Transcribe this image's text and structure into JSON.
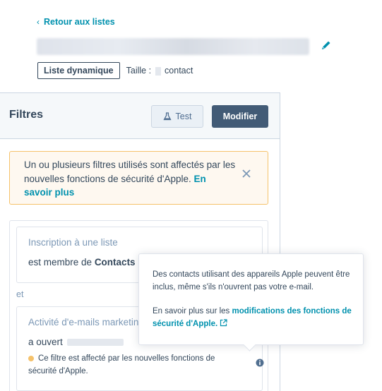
{
  "header": {
    "back_label": "Retour aux listes",
    "list_type": "Liste dynamique",
    "size_label": "Taille :",
    "size_unit": "contact"
  },
  "panel": {
    "title": "Filtres",
    "test_label": "Test",
    "modify_label": "Modifier"
  },
  "alert": {
    "text": "Un ou plusieurs filtres utilisés sont affectés par les nouvelles fonctions de sécurité d'Apple.",
    "link": "En savoir plus"
  },
  "filters": {
    "card1_title": "Inscription à une liste",
    "card1_prefix": "est membre de",
    "card1_value": "Contacts",
    "and_label": "et",
    "card2_title": "Activité d'e-mails marketing",
    "card2_prefix": "a ouvert",
    "card2_warning": "Ce filtre est affecté par les nouvelles fonctions de sécurité d'Apple."
  },
  "tooltip": {
    "paragraph1": "Des contacts utilisant des appareils Apple peuvent être inclus, même s'ils n'ouvrent pas votre e-mail.",
    "paragraph2_prefix": "En savoir plus sur les",
    "paragraph2_link": "modifications des fonctions de sécurité d'Apple."
  },
  "colors": {
    "accent_link": "#0091ae",
    "primary_button": "#425b76",
    "alert_border": "#f5c26b",
    "text": "#33475b"
  },
  "icons": [
    "chevron-left-icon",
    "pencil-icon",
    "beaker-icon",
    "close-icon",
    "info-icon",
    "external-link-icon"
  ]
}
